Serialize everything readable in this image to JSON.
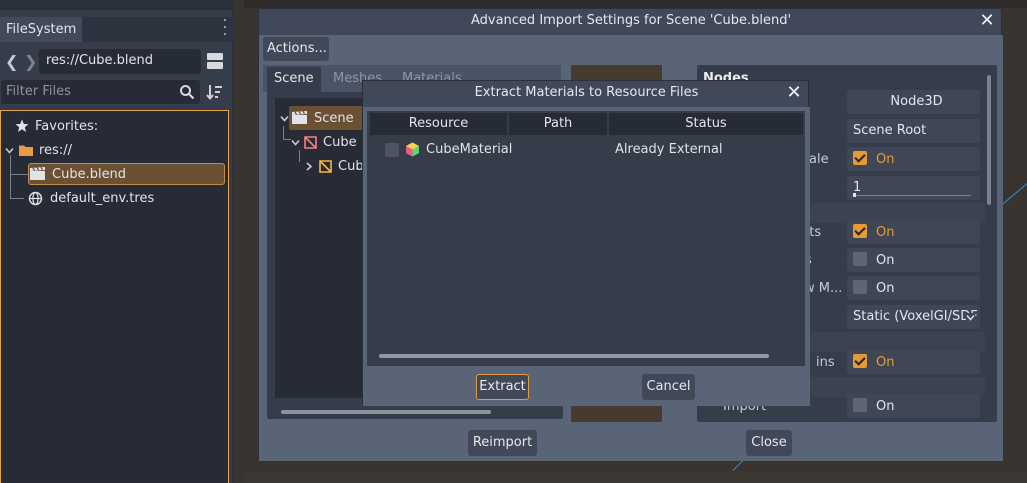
{
  "filesystem": {
    "tab_label": "FileSystem",
    "path": "res://Cube.blend",
    "filter_placeholder": "Filter Files",
    "tree": {
      "favorites": "Favorites:",
      "root": "res://",
      "items": [
        "Cube.blend",
        "default_env.tres"
      ]
    }
  },
  "import_window": {
    "title": "Advanced Import Settings for Scene 'Cube.blend'",
    "actions_label": "Actions...",
    "tabs": [
      "Scene",
      "Meshes",
      "Materials"
    ],
    "scene_tree": [
      "Scene",
      "Cube",
      "Cube"
    ],
    "nodes_header": "Nodes",
    "properties": [
      {
        "label": "",
        "value": "Node3D"
      },
      {
        "label": "",
        "value": "Scene Root"
      },
      {
        "label": "ale",
        "value": "On",
        "checked": true
      },
      {
        "label": "",
        "value": "1"
      },
      {
        "label": "nts",
        "value": "On",
        "checked": true
      },
      {
        "label": "s",
        "value": "On",
        "checked": false
      },
      {
        "label": "w M...",
        "value": "On",
        "checked": false
      },
      {
        "label": "",
        "value": "Static (VoxelGI/SDF"
      },
      {
        "label": "ins",
        "value": "On",
        "checked": true
      },
      {
        "label": "Import",
        "value": "On",
        "checked": false
      }
    ],
    "reimport_label": "Reimport",
    "close_label": "Close"
  },
  "extract_dialog": {
    "title": "Extract Materials to Resource Files",
    "columns": [
      "Resource",
      "Path",
      "Status"
    ],
    "rows": [
      {
        "resource": "CubeMaterial",
        "path": "",
        "status": "Already External",
        "checked": false
      }
    ],
    "extract_label": "Extract",
    "cancel_label": "Cancel"
  },
  "colors": {
    "accent": "#e79933",
    "selection": "#6c5034",
    "panel": "#363d4a",
    "window_body": "#5a6477"
  }
}
